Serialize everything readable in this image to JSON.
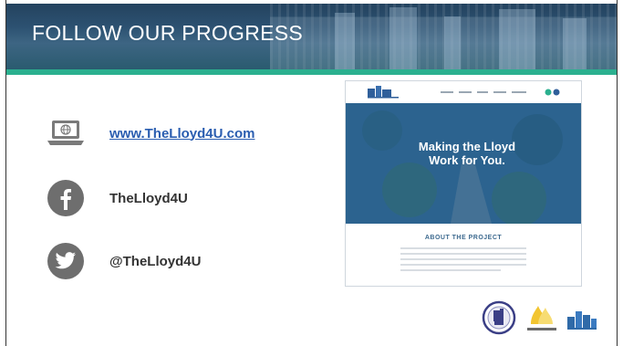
{
  "header": {
    "title": "FOLLOW OUR PROGRESS"
  },
  "contacts": [
    {
      "icon": "laptop-globe-icon",
      "label": "www.TheLloyd4U.com"
    },
    {
      "icon": "facebook-icon",
      "label": "TheLloyd4U"
    },
    {
      "icon": "twitter-icon",
      "label": "@TheLloyd4U"
    }
  ],
  "website_preview": {
    "hero_text": "Making the Lloyd Work for You.",
    "section_heading": "ABOUT THE PROJECT"
  },
  "colors": {
    "header": "#2c5171",
    "accent_bar": "#2bb08f",
    "link": "#2a5db0",
    "icon_gray": "#6e6e6e"
  },
  "logos": [
    "indiana-state-seal-icon",
    "westlovel-logo-icon",
    "lloyd-skyline-logo-icon"
  ]
}
